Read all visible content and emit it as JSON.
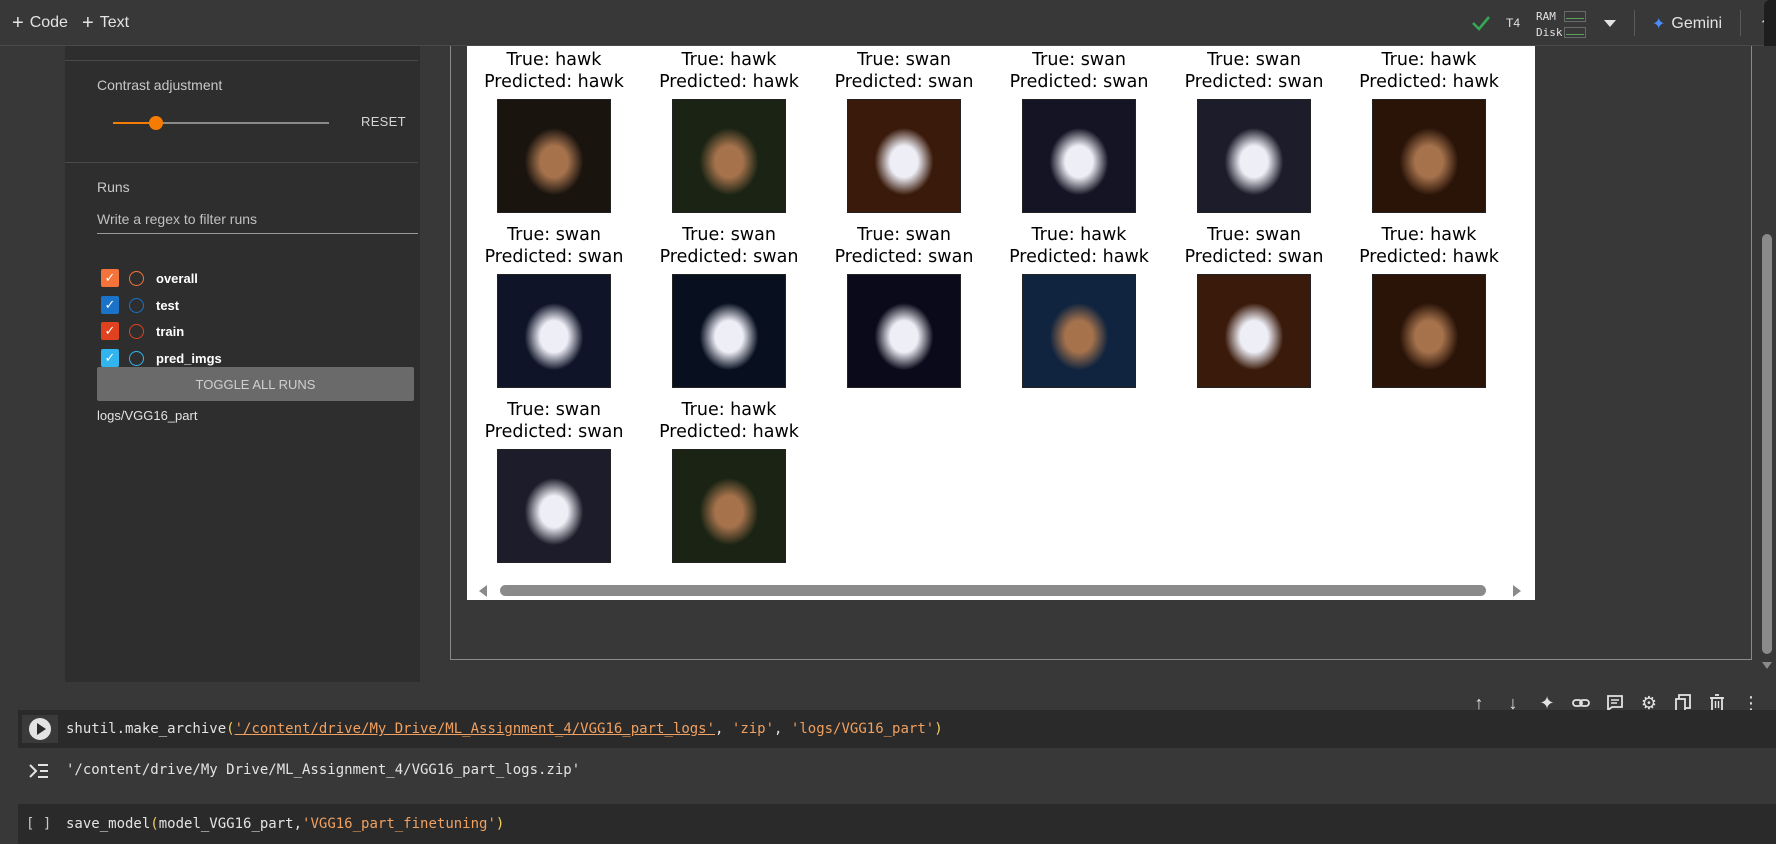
{
  "toolbar": {
    "add_code_label": "Code",
    "add_text_label": "Text",
    "gpu_label": "T4",
    "ram_label": "RAM",
    "disk_label": "Disk",
    "gemini_label": "Gemini"
  },
  "sidebar": {
    "contrast_title": "Contrast adjustment",
    "contrast_value": 0.2,
    "reset_label": "RESET",
    "runs_title": "Runs",
    "filter_placeholder": "Write a regex to filter runs",
    "runs": [
      {
        "label": "overall",
        "checked": true,
        "color": "#f4733a"
      },
      {
        "label": "test",
        "checked": true,
        "color": "#1a73c8"
      },
      {
        "label": "train",
        "checked": true,
        "color": "#e0421f"
      },
      {
        "label": "pred_imgs",
        "checked": true,
        "color": "#32b4ee"
      }
    ],
    "toggle_all_label": "TOGGLE ALL RUNS",
    "log_path": "logs/VGG16_part"
  },
  "predictions": [
    {
      "true_label": "True: hawk",
      "pred_label": "Predicted: hawk"
    },
    {
      "true_label": "True: hawk",
      "pred_label": "Predicted: hawk"
    },
    {
      "true_label": "True: swan",
      "pred_label": "Predicted: swan"
    },
    {
      "true_label": "True: swan",
      "pred_label": "Predicted: swan"
    },
    {
      "true_label": "True: swan",
      "pred_label": "Predicted: swan"
    },
    {
      "true_label": "True: hawk",
      "pred_label": "Predicted: hawk"
    },
    {
      "true_label": "True: swan",
      "pred_label": "Predicted: swan"
    },
    {
      "true_label": "True: swan",
      "pred_label": "Predicted: swan"
    },
    {
      "true_label": "True: swan",
      "pred_label": "Predicted: swan"
    },
    {
      "true_label": "True: hawk",
      "pred_label": "Predicted: hawk"
    },
    {
      "true_label": "True: swan",
      "pred_label": "Predicted: swan"
    },
    {
      "true_label": "True: hawk",
      "pred_label": "Predicted: hawk"
    },
    {
      "true_label": "True: swan",
      "pred_label": "Predicted: swan"
    },
    {
      "true_label": "True: hawk",
      "pred_label": "Predicted: hawk"
    }
  ],
  "cells": {
    "cell1": {
      "fn": "shutil.make_archive",
      "arg1": "'/content/drive/My Drive/ML_Assignment_4/VGG16_part_logs'",
      "arg2": "'zip'",
      "arg3": "'logs/VGG16_part'",
      "output": "'/content/drive/My Drive/ML_Assignment_4/VGG16_part_logs.zip'"
    },
    "cell2": {
      "bracket": "[ ]",
      "fn": "save_model",
      "arg1": "model_VGG16_part",
      "arg2": "'VGG16_part_finetuning'"
    }
  }
}
